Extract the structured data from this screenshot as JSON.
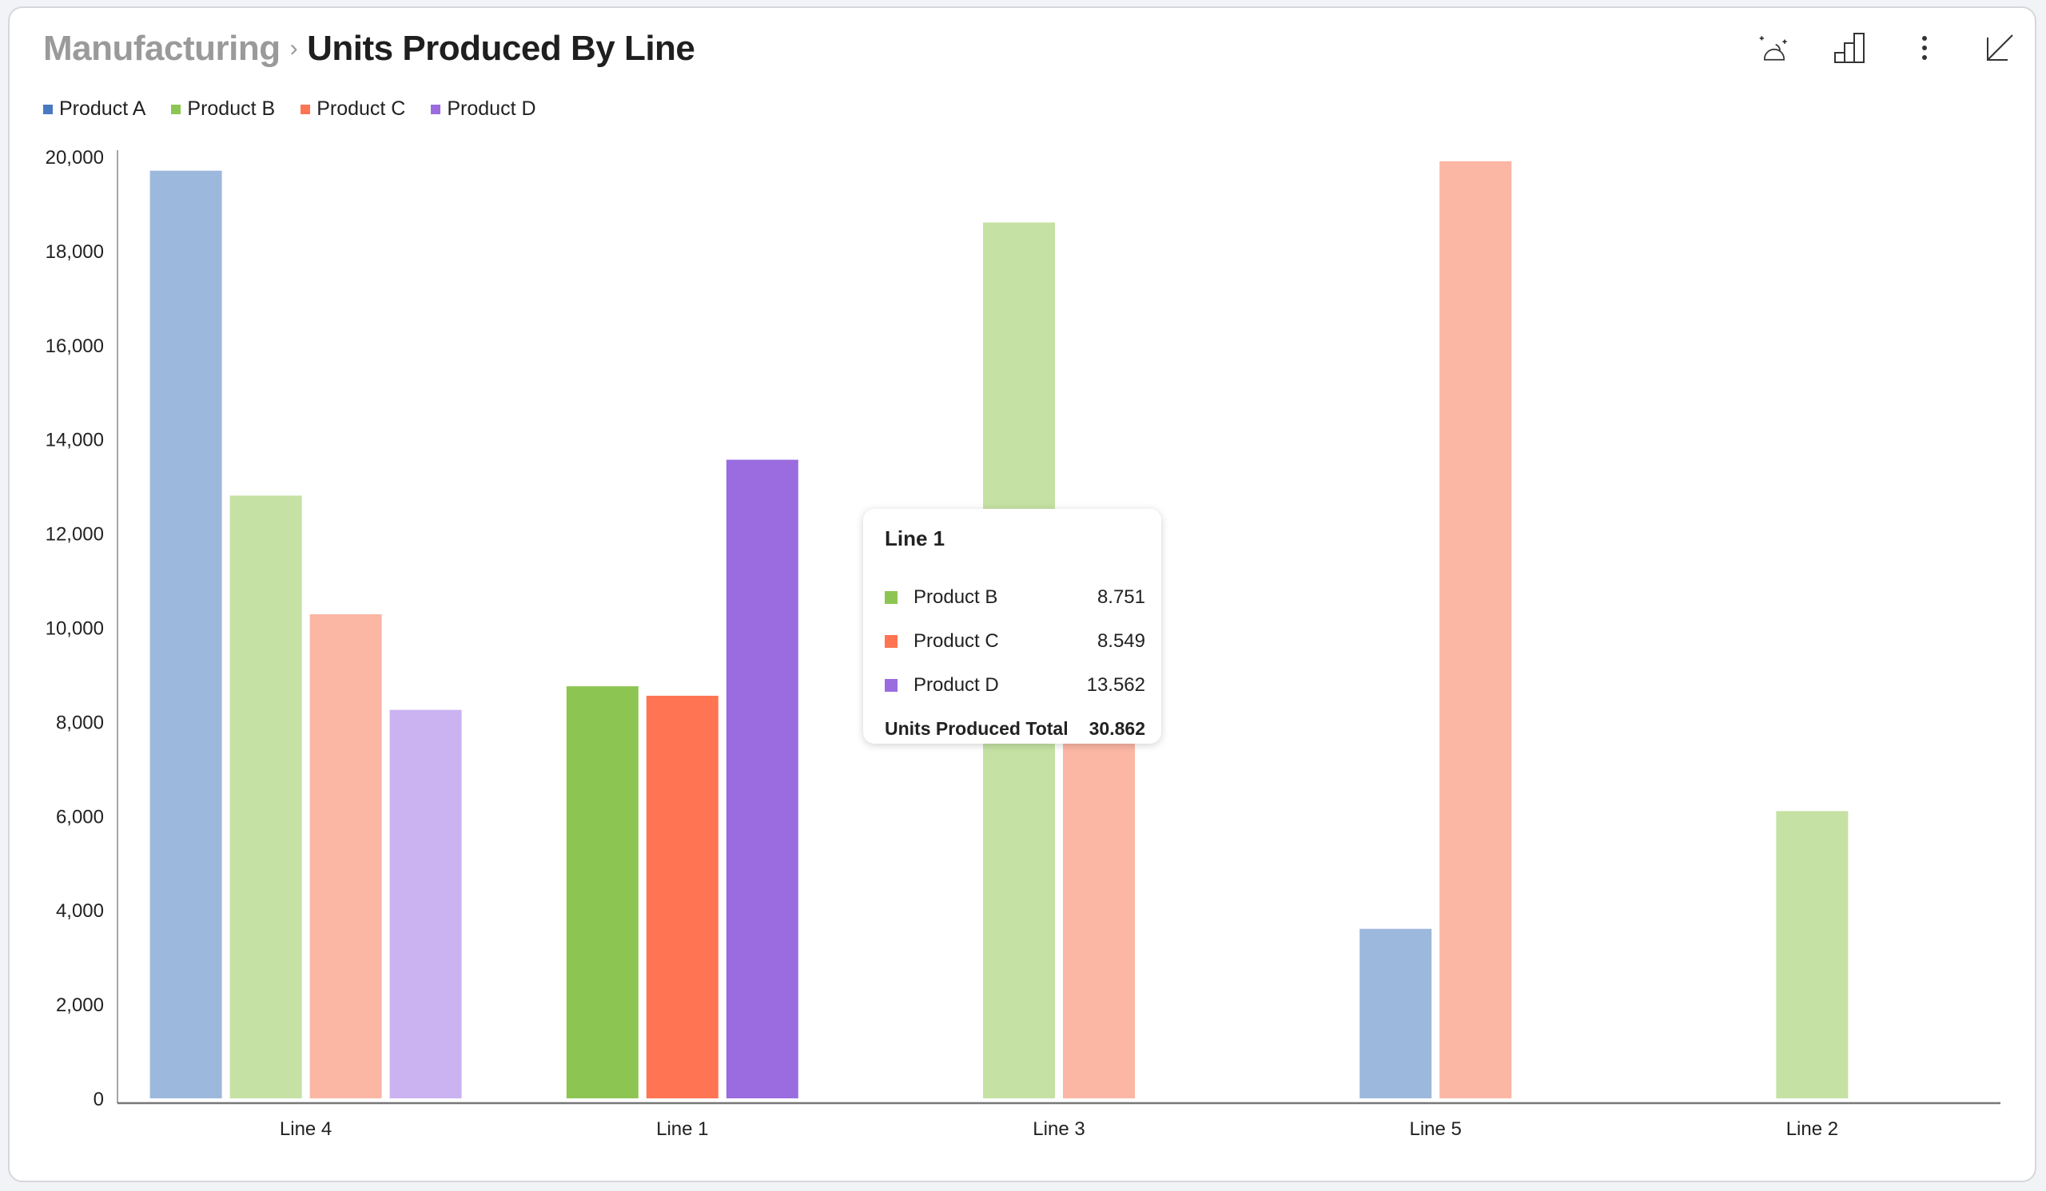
{
  "header": {
    "breadcrumb": "Manufacturing",
    "separator": "›",
    "title": "Units Produced By Line"
  },
  "toolbar": {
    "icons": [
      "ai-insights-icon",
      "chart-type-icon",
      "more-options-icon",
      "minimize-icon"
    ]
  },
  "legend": [
    {
      "label": "Product A",
      "color": "#4a78c2"
    },
    {
      "label": "Product B",
      "color": "#8dc553"
    },
    {
      "label": "Product C",
      "color": "#ff7452"
    },
    {
      "label": "Product D",
      "color": "#9a6ce0"
    }
  ],
  "chart_data": {
    "type": "bar",
    "title": "Units Produced By Line",
    "xlabel": "",
    "ylabel": "",
    "ylim": [
      0,
      20000
    ],
    "yticks": [
      0,
      2000,
      4000,
      6000,
      8000,
      10000,
      12000,
      14000,
      16000,
      18000,
      20000
    ],
    "ytick_labels": [
      "0",
      "2,000",
      "4,000",
      "6,000",
      "8,000",
      "10,000",
      "12,000",
      "14,000",
      "16,000",
      "18,000",
      "20,000"
    ],
    "categories": [
      "Line 4",
      "Line 1",
      "Line 3",
      "Line 5",
      "Line 2"
    ],
    "highlighted_category": "Line 1",
    "grid": false,
    "legend_position": "top-left",
    "series": [
      {
        "name": "Product A",
        "color": "#4a78c2",
        "faded_color": "#9db8dd",
        "values": [
          19700,
          null,
          null,
          3600,
          null
        ]
      },
      {
        "name": "Product B",
        "color": "#8dc553",
        "faded_color": "#c5e1a3",
        "values": [
          12800,
          8751,
          18600,
          null,
          6100
        ]
      },
      {
        "name": "Product C",
        "color": "#ff7452",
        "faded_color": "#fbb6a4",
        "values": [
          10280,
          8549,
          8000,
          19900,
          null
        ]
      },
      {
        "name": "Product D",
        "color": "#9a6ce0",
        "faded_color": "#cbb2f1",
        "values": [
          8250,
          13562,
          null,
          null,
          null
        ]
      }
    ]
  },
  "tooltip": {
    "title": "Line 1",
    "rows": [
      {
        "label": "Product B",
        "value": "8.751",
        "color": "#8dc553"
      },
      {
        "label": "Product C",
        "value": "8.549",
        "color": "#ff7452"
      },
      {
        "label": "Product D",
        "value": "13.562",
        "color": "#9a6ce0"
      }
    ],
    "total_label": "Units Produced Total",
    "total_value": "30.862"
  }
}
